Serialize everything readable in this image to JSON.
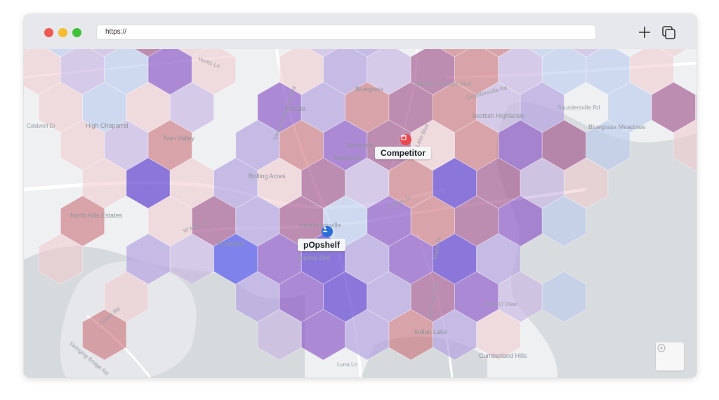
{
  "browser": {
    "url": "https://",
    "icons": [
      "close-dot",
      "minimize-dot",
      "maximize-dot",
      "plus-icon",
      "tabs-icon"
    ]
  },
  "map": {
    "markers": [
      {
        "label": "Competitor",
        "icon": "store-icon",
        "color": "#e8474b"
      },
      {
        "label": "pOpshelf",
        "icon": "store-person-icon",
        "color": "#2b6fd6"
      }
    ],
    "road_labels": [
      "Vietnam Veterans Blvd",
      "Vietnam Veterans Blvd",
      "Saundersville Rd",
      "Saundersville Rd",
      "Lake Blvd",
      "Caldwell Dr",
      "High Chaparral",
      "Twin Valley",
      "Hillside",
      "Bluegrass",
      "Scottish Highlands",
      "Bluegrass Meadows",
      "Westgate",
      "Meadows",
      "Rolling Acres",
      "E Main St",
      "W Main St",
      "North Hills Estates",
      "Rockland",
      "Imperial Blvd",
      "Maple Dr",
      "Point O View",
      "Indian Lake Rd",
      "Cinder Rd",
      "Swinging Bridge Rd",
      "Cumberland Hills",
      "Indian Lake",
      "Luna Ln",
      "Hunts Ln",
      "Hendersonville"
    ],
    "hex_colors": {
      "deep_blue": "#5b5ee8",
      "violet": "#6a4fd1",
      "purple": "#8f5cc7",
      "plum": "#a3568e",
      "rose": "#c96f78",
      "light_blue": "#b9c9ec",
      "light_pink": "#f0c9cc",
      "light_purple": "#c7b6e2",
      "lavender": "#b4a4df"
    }
  }
}
